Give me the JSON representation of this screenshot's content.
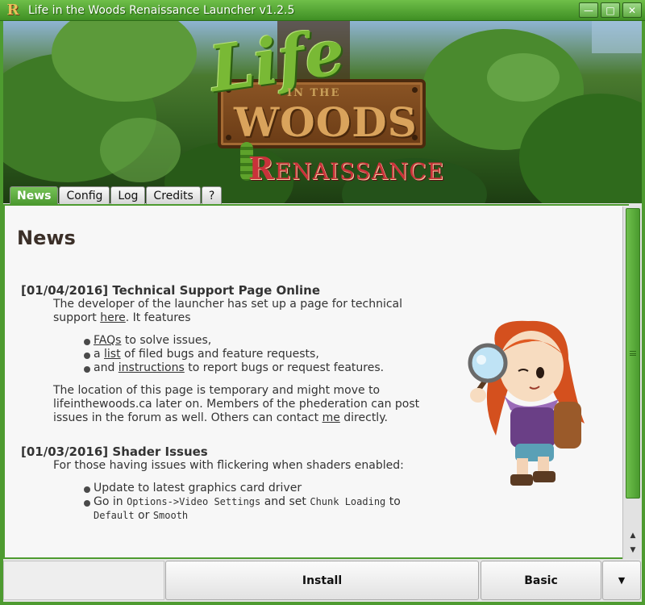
{
  "window": {
    "app_icon_letter": "R",
    "title": "Life in the Woods Renaissance Launcher v1.2.5",
    "minimize_glyph": "—",
    "maximize_glyph": "□",
    "close_glyph": "✕"
  },
  "banner": {
    "logo_script": "Life",
    "logo_in_the": "IN THE",
    "logo_woods": "WOODS",
    "logo_renaissance_initial": "R",
    "logo_renaissance_rest": "ENAISSANCE"
  },
  "tabs": [
    {
      "label": "News",
      "active": true
    },
    {
      "label": "Config",
      "active": false
    },
    {
      "label": "Log",
      "active": false
    },
    {
      "label": "Credits",
      "active": false
    },
    {
      "label": "?",
      "active": false
    }
  ],
  "news": {
    "heading": "News",
    "articles": [
      {
        "title": "[01/04/2016] Technical Support Page Online",
        "intro_before_link": "The developer of the launcher has set up a page for technical support ",
        "intro_link": "here",
        "intro_after_link": ". It features",
        "bullets": [
          {
            "link": "FAQs",
            "after": " to solve issues,"
          },
          {
            "before": "a ",
            "link": "list",
            "after": " of filed bugs and feature requests,"
          },
          {
            "before": "and ",
            "link": "instructions",
            "after": " to report bugs or request features."
          }
        ],
        "outro_before_link": "The location of this page is temporary and might move to lifeinthewoods.ca later on. Members of the phederation can post issues in the forum as well. Others can contact ",
        "outro_link": "me",
        "outro_after_link": " directly."
      },
      {
        "title": "[01/03/2016] Shader Issues",
        "intro": "For those having issues with flickering when shaders enabled:",
        "bullet1": "Update to latest graphics card driver",
        "bullet2_a": "Go in ",
        "bullet2_code1": "Options->Video Settings",
        "bullet2_b": " and set ",
        "bullet2_code2": "Chunk Loading",
        "bullet2_c": " to ",
        "bullet2_code3": "Default",
        "bullet2_d": " or ",
        "bullet2_code4": "Smooth"
      }
    ]
  },
  "bottom": {
    "status_text": "",
    "install_label": "Install",
    "mode_label": "Basic",
    "dropdown_glyph": "▼"
  },
  "colors": {
    "accent_green": "#4e9b30",
    "title_bar_green": "#3f8f24",
    "logo_red": "#c9323a"
  }
}
